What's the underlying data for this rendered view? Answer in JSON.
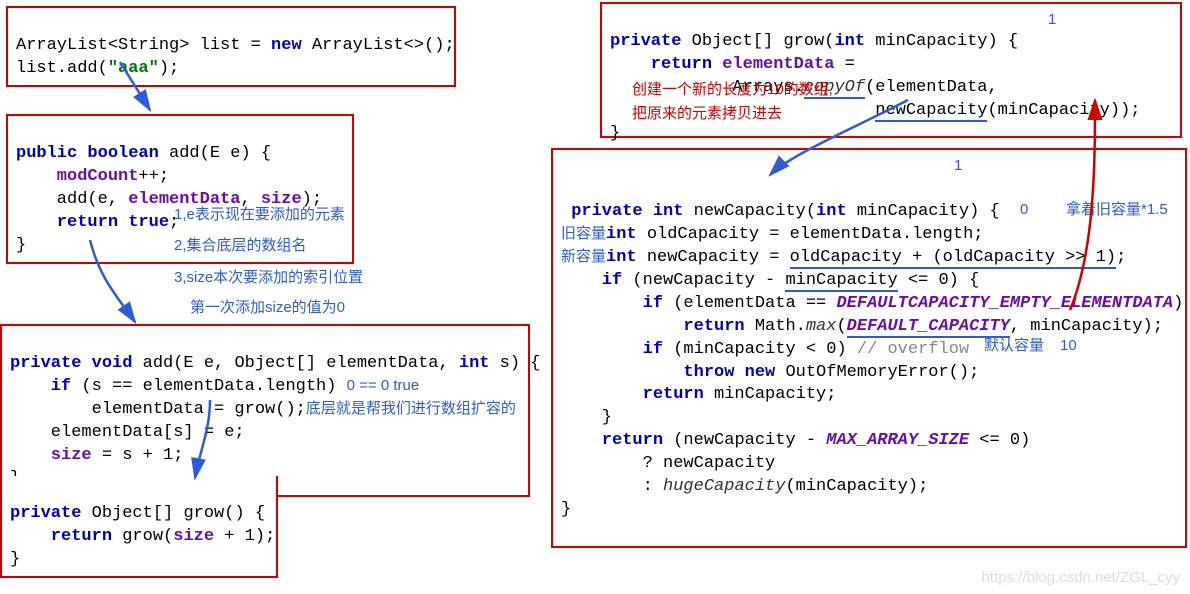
{
  "boxes": {
    "caller": {
      "line1_a": "ArrayList<String> list = ",
      "line1_b": "new",
      "line1_c": " ArrayList<>();",
      "line2_a": "list.add(",
      "line2_b": "\"aaa\"",
      "line2_c": ");"
    },
    "addE": {
      "sig_a": "public boolean",
      "sig_b": " add(E e) {",
      "l1_a": "    modCount",
      "l1_b": "++;",
      "l2_a": "    add(e, ",
      "l2_b": "elementData",
      "l2_c": ", ",
      "l2_d": "size",
      "l2_e": ");",
      "l3_a": "    return ",
      "l3_b": "true",
      "l3_c": ";",
      "close": "}"
    },
    "addEOs": {
      "sig_a": "private void",
      "sig_b": " add(E e, Object[] elementData, ",
      "sig_c": "int",
      "sig_d": " s) {",
      "l1_a": "    if",
      "l1_b": " (s == elementData.length)",
      "l2": "        elementData = grow();",
      "l3": "    elementData[s] = e;",
      "l4_a": "    size",
      "l4_b": " = s + 1;",
      "close": "}"
    },
    "grow0": {
      "sig_a": "private",
      "sig_b": " Object[] grow() {",
      "l1_a": "    return",
      "l1_b": " grow(",
      "l1_c": "size",
      "l1_d": " + 1);",
      "close": "}"
    },
    "growMin": {
      "sig_a": "private",
      "sig_b": " Object[] grow(",
      "sig_c": "int",
      "sig_d": " minCapacity) {",
      "l1_a": "    return ",
      "l1_b": "elementData",
      "l1_c": " =",
      "l2_a": "            Arrays.",
      "l2_b": "copyOf",
      "l2_c": "(elementData,",
      "l3_a": "                          ",
      "l3_b": "newCapacity",
      "l3_c": "(minCapacity));",
      "close": "}"
    },
    "newCap": {
      "sig_a": "private int",
      "sig_b": " newCapacity(",
      "sig_c": "int",
      "sig_d": " minCapacity) {",
      "l1_a": "int",
      "l1_b": " oldCapacity = elementData.length;",
      "l2_a": "int",
      "l2_b": " newCapacity = ",
      "l2_c": "oldCapacity + (oldCapacity >> 1)",
      "l2_d": ";",
      "l3_a": "    if",
      "l3_b": " (newCapacity - ",
      "l3_c": "minCapacity",
      "l3_d": " <= 0) {",
      "l4_a": "        if",
      "l4_b": " (elementData == ",
      "l4_c": "DEFAULTCAPACITY_EMPTY_ELEMENTDATA",
      "l4_d": ")",
      "l5_a": "            return",
      "l5_b": " Math.",
      "l5_c": "max",
      "l5_d": "(",
      "l5_e": "DEFAULT_CAPACITY",
      "l5_f": ", minCapacity);",
      "l6_a": "        if",
      "l6_b": " (minCapacity < 0) ",
      "l6_c": "// overflow",
      "l7_a": "            throw new",
      "l7_b": " OutOfMemoryError();",
      "l8_a": "        return",
      "l8_b": " minCapacity;",
      "l9": "    }",
      "l10_a": "    return",
      "l10_b": " (newCapacity - ",
      "l10_c": "MAX_ARRAY_SIZE",
      "l10_d": " <= 0)",
      "l11": "        ? newCapacity",
      "l12_a": "        : ",
      "l12_b": "hugeCapacity",
      "l12_c": "(minCapacity);",
      "close": "}"
    }
  },
  "annotations": {
    "addE_1": "1,e表示现在要添加的元素",
    "addE_2": "2,集合底层的数组名",
    "addE_3": "3,size本次要添加的索引位置",
    "addE_4": "第一次添加size的值为0",
    "addEOs_cond": "0 == 0 true",
    "addEOs_grow": "底层就是帮我们进行数组扩容的",
    "growMin_num": "1",
    "growMin_red1": "创建一个新的长度为10的数组,",
    "growMin_red2": "把原来的元素拷贝进去",
    "newCap_num": "1",
    "newCap_old": "旧容量",
    "newCap_new": "新容量",
    "newCap_zero": "0",
    "newCap_mult": "拿着旧容量*1.5",
    "newCap_def": "默认容量",
    "newCap_ten": "10"
  },
  "watermark": "https://blog.csdn.net/ZGL_cyy"
}
